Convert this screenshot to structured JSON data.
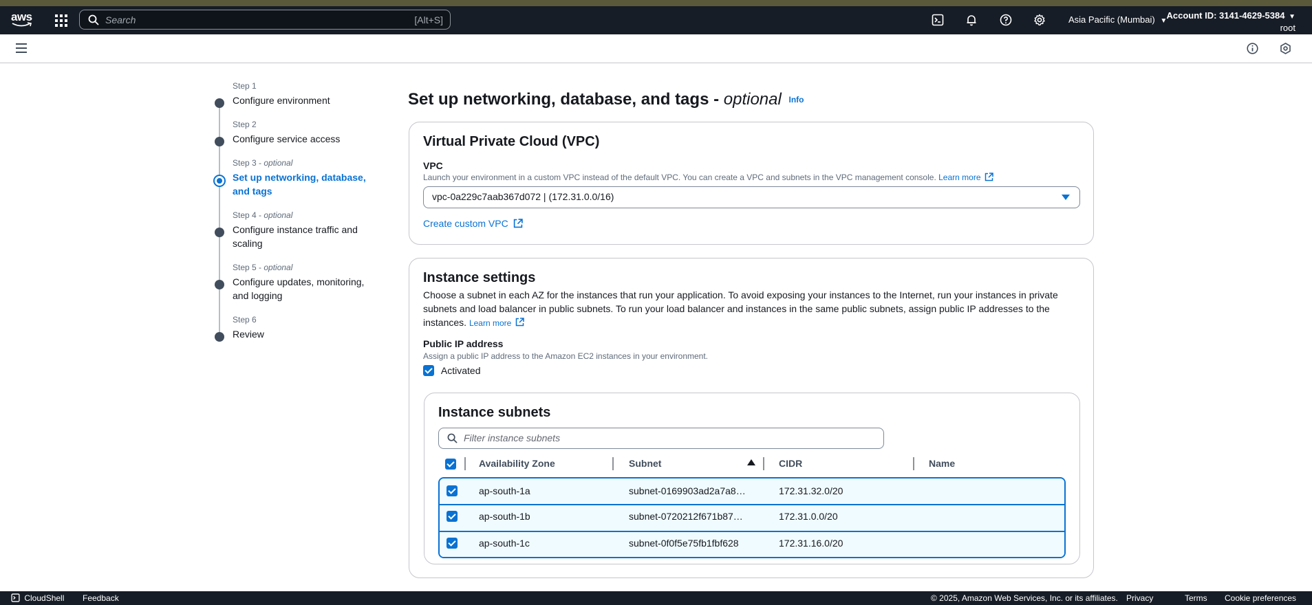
{
  "topnav": {
    "logo_text": "aws",
    "search_placeholder": "Search",
    "search_shortcut": "[Alt+S]",
    "region": "Asia Pacific (Mumbai)",
    "account_id": "Account ID: 3141-4629-5384",
    "account_role": "root"
  },
  "steps": [
    {
      "num": "Step 1",
      "optional": "",
      "title": "Configure environment"
    },
    {
      "num": "Step 2",
      "optional": "",
      "title": "Configure service access"
    },
    {
      "num": "Step 3 - ",
      "optional": "optional",
      "title": "Set up networking, database, and tags"
    },
    {
      "num": "Step 4 - ",
      "optional": "optional",
      "title": "Configure instance traffic and scaling"
    },
    {
      "num": "Step 5 - ",
      "optional": "optional",
      "title": "Configure updates, monitoring, and logging"
    },
    {
      "num": "Step 6",
      "optional": "",
      "title": "Review"
    }
  ],
  "page": {
    "title": "Set up networking, database, and tags - ",
    "title_optional": "optional",
    "info": "Info"
  },
  "vpc": {
    "heading": "Virtual Private Cloud (VPC)",
    "label": "VPC",
    "description": "Launch your environment in a custom VPC instead of the default VPC. You can create a VPC and subnets in the VPC management console.",
    "learn_more": "Learn more",
    "selected": "vpc-0a229c7aab367d072 | (172.31.0.0/16)",
    "create_link": "Create custom VPC"
  },
  "instance": {
    "heading": "Instance settings",
    "description": "Choose a subnet in each AZ for the instances that run your application. To avoid exposing your instances to the Internet, run your instances in private subnets and load balancer in public subnets. To run your load balancer and instances in the same public subnets, assign public IP addresses to the instances.",
    "learn_more": "Learn more",
    "public_ip_label": "Public IP address",
    "public_ip_desc": "Assign a public IP address to the Amazon EC2 instances in your environment.",
    "activated_label": "Activated",
    "activated": true
  },
  "subnets": {
    "heading": "Instance subnets",
    "filter_placeholder": "Filter instance subnets",
    "columns": [
      "Availability Zone",
      "Subnet",
      "CIDR",
      "Name"
    ],
    "rows": [
      {
        "az": "ap-south-1a",
        "subnet": "subnet-0169903ad2a7a8…",
        "cidr": "172.31.32.0/20",
        "name": "",
        "checked": true
      },
      {
        "az": "ap-south-1b",
        "subnet": "subnet-0720212f671b87…",
        "cidr": "172.31.0.0/20",
        "name": "",
        "checked": true
      },
      {
        "az": "ap-south-1c",
        "subnet": "subnet-0f0f5e75fb1fbf628",
        "cidr": "172.31.16.0/20",
        "name": "",
        "checked": true
      }
    ]
  },
  "footer": {
    "cloudshell": "CloudShell",
    "feedback": "Feedback",
    "copyright": "© 2025, Amazon Web Services, Inc. or its affiliates.",
    "privacy": "Privacy",
    "terms": "Terms",
    "cookies": "Cookie preferences"
  },
  "colors": {
    "accent": "#0972d3",
    "nav_bg": "#161d26"
  }
}
